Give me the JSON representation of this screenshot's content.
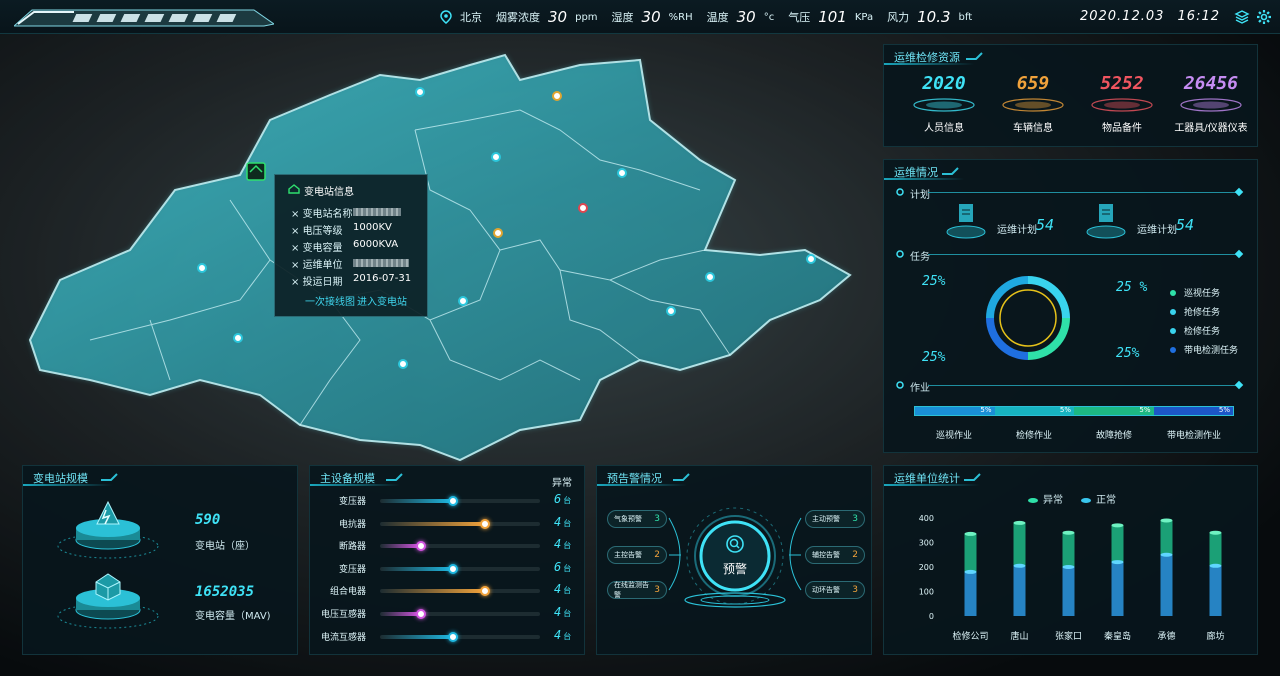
{
  "header": {
    "logo_alt": "logo",
    "weather": {
      "city": "北京",
      "smoke_label": "烟雾浓度",
      "smoke_value": "30",
      "smoke_unit": "ppm",
      "humidity_label": "湿度",
      "humidity_value": "30",
      "humidity_unit": "%RH",
      "temp_label": "温度",
      "temp_value": "30",
      "temp_unit": "°c",
      "pressure_label": "气压",
      "pressure_value": "101",
      "pressure_unit": "KPa",
      "wind_label": "风力",
      "wind_value": "10.3",
      "wind_unit": "bft"
    },
    "date": "2020.12.03",
    "time": "16:12",
    "icons": [
      "layers-icon",
      "settings-icon"
    ]
  },
  "popup": {
    "title": "变电站信息",
    "rows": [
      {
        "label": "变电站名称",
        "value": ""
      },
      {
        "label": "电压等级",
        "value": "1000KV"
      },
      {
        "label": "变电容量",
        "value": "6000KVA"
      },
      {
        "label": "运维单位",
        "value": ""
      },
      {
        "label": "投运日期",
        "value": "2016-07-31"
      }
    ],
    "link1": "一次接线图",
    "link2": "进入变电站"
  },
  "resources": {
    "title": "运维检修资源",
    "items": [
      {
        "value": "2020",
        "label": "人员信息",
        "color": "#3fe2f6"
      },
      {
        "value": "659",
        "label": "车辆信息",
        "color": "#f0a23b"
      },
      {
        "value": "5252",
        "label": "物品备件",
        "color": "#f05560"
      },
      {
        "value": "26456",
        "label": "工器具/仪器仪表",
        "color": "#c58cf2"
      }
    ]
  },
  "ops": {
    "title": "运维情况",
    "plan_label": "计划",
    "plans": [
      {
        "label": "运维计划",
        "value": "54"
      },
      {
        "label": "运维计划",
        "value": "54"
      }
    ],
    "task_label": "任务",
    "donut_pcts": [
      "25%",
      "25 %",
      "25%",
      "25%"
    ],
    "legend": [
      {
        "label": "巡视任务",
        "color": "#2fe0a8"
      },
      {
        "label": "抢修任务",
        "color": "#39d3ee"
      },
      {
        "label": "检修任务",
        "color": "#39d3ee"
      },
      {
        "label": "带电检测任务",
        "color": "#1f6fe0"
      }
    ],
    "work_label": "作业",
    "bar_segments": [
      {
        "label": "巡视作业",
        "value": "5%",
        "color": "#1a8fd6"
      },
      {
        "label": "检修作业",
        "value": "5%",
        "color": "#17b3c0"
      },
      {
        "label": "故障抢修",
        "value": "5%",
        "color": "#1db883"
      },
      {
        "label": "带电检测作业",
        "value": "5%",
        "color": "#1c56c7"
      }
    ]
  },
  "substation": {
    "title": "变电站规模",
    "count_value": "590",
    "count_label": "变电站（座）",
    "capacity_value": "1652035",
    "capacity_label": "变电容量（MAV)"
  },
  "equipment": {
    "title": "主设备规模",
    "col_header": "异常",
    "unit": "台",
    "items": [
      {
        "name": "变压器",
        "value": "6",
        "fill": 0.45,
        "color": "#1fb7e0"
      },
      {
        "name": "电抗器",
        "value": "4",
        "fill": 0.65,
        "color": "#f0a23b"
      },
      {
        "name": "断路器",
        "value": "4",
        "fill": 0.25,
        "color": "#d255e0"
      },
      {
        "name": "变压器",
        "value": "6",
        "fill": 0.45,
        "color": "#1fb7e0"
      },
      {
        "name": "组合电器",
        "value": "4",
        "fill": 0.65,
        "color": "#f0a23b"
      },
      {
        "name": "电压互感器",
        "value": "4",
        "fill": 0.25,
        "color": "#d255e0"
      },
      {
        "name": "电流互感器",
        "value": "4",
        "fill": 0.45,
        "color": "#1fb7e0"
      }
    ]
  },
  "alerts": {
    "title": "预告警情况",
    "center_label": "预警",
    "left": [
      {
        "name": "气象预警",
        "value": "3",
        "color": "#2fe0a8"
      },
      {
        "name": "主控告警",
        "value": "2",
        "color": "#f0a23b"
      },
      {
        "name": "在线监测告警",
        "value": "3",
        "color": "#f0a23b"
      }
    ],
    "right": [
      {
        "name": "主动预警",
        "value": "3",
        "color": "#2fe0a8"
      },
      {
        "name": "辅控告警",
        "value": "2",
        "color": "#f0a23b"
      },
      {
        "name": "动环告警",
        "value": "3",
        "color": "#f0a23b"
      }
    ]
  },
  "unit_stats": {
    "title": "运维单位统计",
    "legend": [
      {
        "label": "异常",
        "color": "#2fe0a8"
      },
      {
        "label": "正常",
        "color": "#39c6ee"
      }
    ]
  },
  "chart_data": {
    "type": "bar",
    "categories": [
      "检修公司",
      "唐山",
      "张家口",
      "秦皇岛",
      "承德",
      "廊坊"
    ],
    "series": [
      {
        "name": "正常",
        "values": [
          180,
          205,
          200,
          220,
          250,
          205
        ]
      },
      {
        "name": "异常",
        "values": [
          155,
          175,
          140,
          150,
          140,
          135
        ]
      }
    ],
    "ylim": [
      0,
      400
    ],
    "yticks": [
      0,
      100,
      200,
      300,
      400
    ],
    "stacked": true,
    "legend_position": "top"
  }
}
